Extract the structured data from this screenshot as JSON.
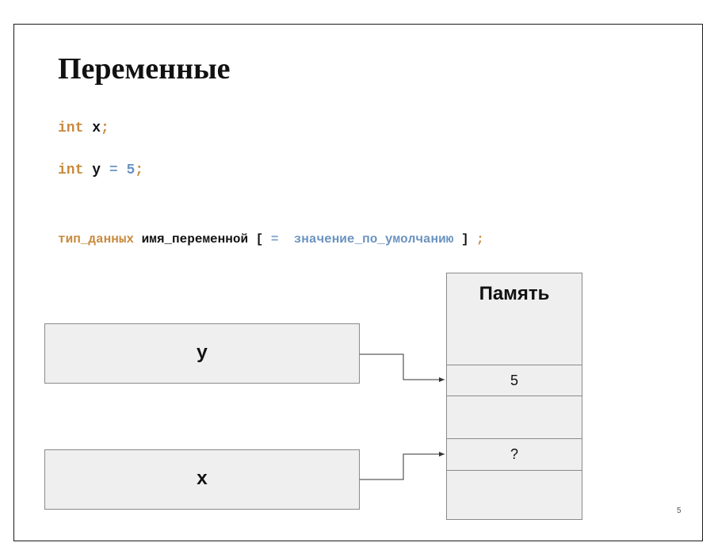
{
  "slide": {
    "title": "Переменные",
    "page_number": "5"
  },
  "code": {
    "line1": {
      "type": "int",
      "name": "x",
      "end": ";"
    },
    "line2": {
      "type": "int",
      "name": "y",
      "op": "=",
      "value": "5",
      "end": ";"
    },
    "syntax": {
      "type": "тип_данных",
      "name": "имя_переменной",
      "open": "[",
      "op": "=",
      "default": "значение_по_умолчанию",
      "close": "]",
      "end": ";"
    }
  },
  "diagram": {
    "variables": [
      {
        "label": "y"
      },
      {
        "label": "x"
      }
    ],
    "memory": {
      "title": "Память",
      "cells": [
        "5",
        "",
        "?",
        ""
      ]
    }
  }
}
